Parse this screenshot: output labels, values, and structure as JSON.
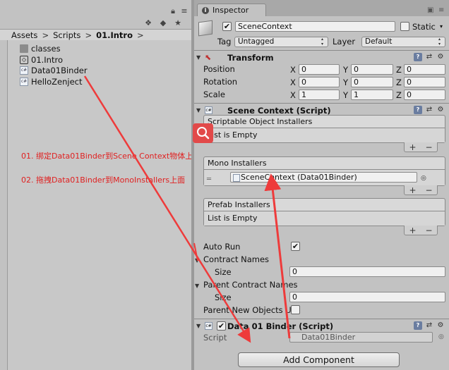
{
  "project": {
    "breadcrumb": [
      "Assets",
      "Scripts",
      "01.Intro"
    ],
    "breadcrumb_sep": ">",
    "toolbar_icons": [
      "lock-icon",
      "menu-icon",
      "filter-icon",
      "label-icon",
      "star-icon"
    ],
    "files": [
      {
        "name": "classes",
        "icon": "folder-icon"
      },
      {
        "name": "01.Intro",
        "icon": "unity-scene-icon"
      },
      {
        "name": "Data01Binder",
        "icon": "csharp-script-icon"
      },
      {
        "name": "HelloZenject",
        "icon": "csharp-script-icon"
      }
    ]
  },
  "annotations": {
    "step1": "01. 绑定Data01Binder到Scene Context物体上面",
    "step2": "02. 拖拽Data01Binder到MonoInstallers上面"
  },
  "inspector": {
    "tab_label": "Inspector",
    "gameobject": {
      "active": true,
      "name": "SceneContext",
      "static_label": "Static",
      "static_checked": false,
      "tag_label": "Tag",
      "tag_value": "Untagged",
      "layer_label": "Layer",
      "layer_value": "Default"
    },
    "transform": {
      "title": "Transform",
      "rows": [
        {
          "label": "Position",
          "x": "0",
          "y": "0",
          "z": "0"
        },
        {
          "label": "Rotation",
          "x": "0",
          "y": "0",
          "z": "0"
        },
        {
          "label": "Scale",
          "x": "1",
          "y": "1",
          "z": "0"
        }
      ],
      "axis_labels": [
        "X",
        "Y",
        "Z"
      ]
    },
    "scene_context": {
      "title": "Scene Context (Script)",
      "scriptable_title": "Scriptable Object Installers",
      "scriptable_body": "List is Empty",
      "mono_title": "Mono Installers",
      "mono_item": "SceneContext (Data01Binder)",
      "prefab_title": "Prefab Installers",
      "prefab_body": "List is Empty",
      "auto_run_label": "Auto Run",
      "auto_run": true,
      "contract_names_label": "Contract Names",
      "contract_size_label": "Size",
      "contract_size": "0",
      "parent_contract_label": "Parent Contract Names",
      "parent_size_label": "Size",
      "parent_size": "0",
      "parent_new_label": "Parent New Objects U",
      "parent_new": false
    },
    "data01": {
      "title": "Data 01 Binder (Script)",
      "enabled": true,
      "script_label": "Script",
      "script_value": "Data01Binder"
    },
    "add_component": "Add Component"
  },
  "colors": {
    "annotation": "#e02020",
    "arrow": "#ee3b3b"
  }
}
